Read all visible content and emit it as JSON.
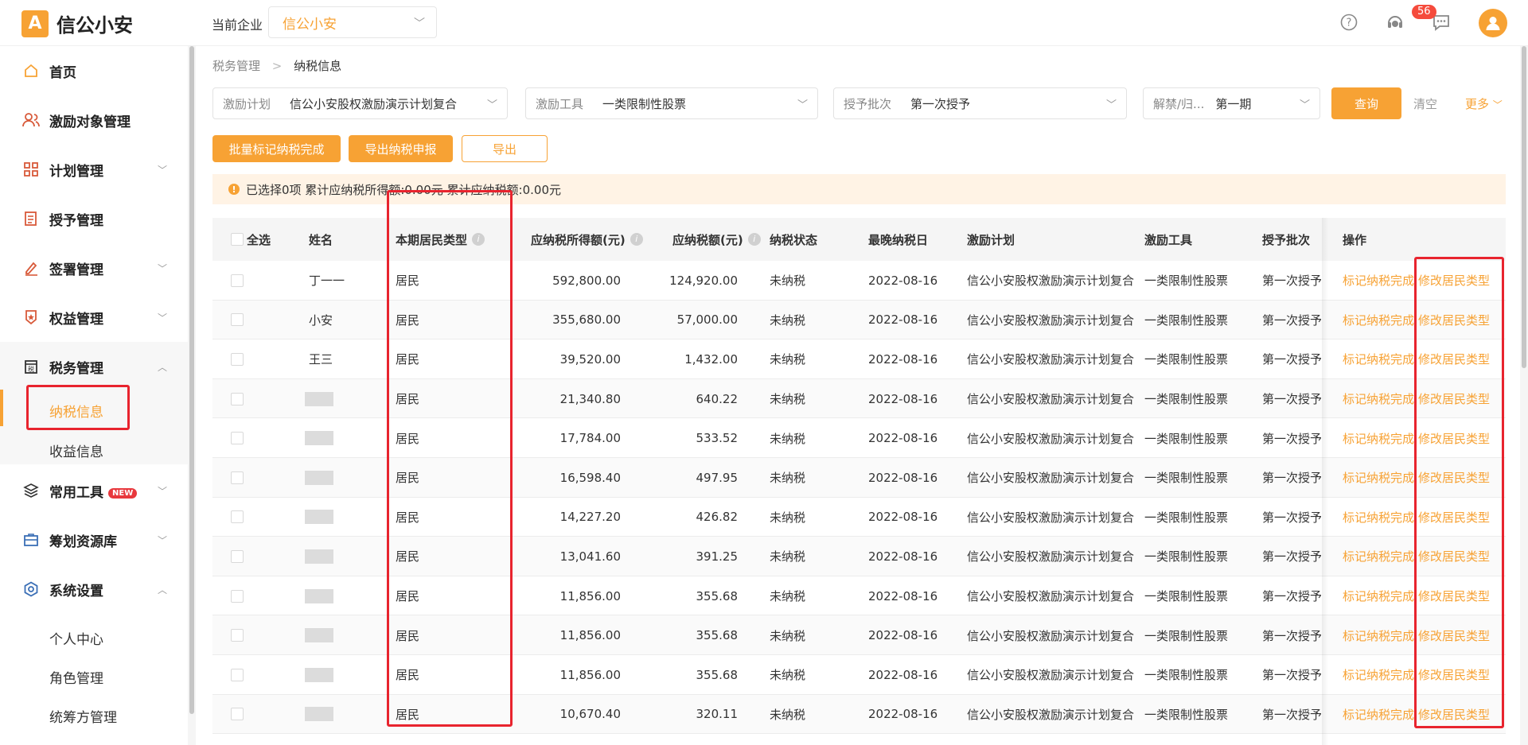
{
  "header": {
    "logo_mark": "A",
    "logo_text": "信公小安",
    "company_label": "当前企业",
    "company_value": "信公小安",
    "message_count": "56"
  },
  "sidebar": {
    "items": [
      {
        "label": "首页",
        "icon": "home-icon"
      },
      {
        "label": "激励对象管理",
        "icon": "users-icon"
      },
      {
        "label": "计划管理",
        "icon": "grid-icon"
      },
      {
        "label": "授予管理",
        "icon": "document-icon"
      },
      {
        "label": "签署管理",
        "icon": "pen-icon"
      },
      {
        "label": "权益管理",
        "icon": "star-icon"
      },
      {
        "label": "税务管理",
        "icon": "tax-icon"
      },
      {
        "label": "常用工具",
        "icon": "layers-icon"
      },
      {
        "label": "筹划资源库",
        "icon": "box-icon"
      },
      {
        "label": "系统设置",
        "icon": "settings-icon"
      }
    ],
    "tax_sub": [
      "纳税信息",
      "收益信息"
    ],
    "settings_sub": [
      "个人中心",
      "角色管理",
      "统筹方管理"
    ],
    "new_badge": "NEW"
  },
  "breadcrumb": {
    "parent": "税务管理",
    "separator": ">",
    "current": "纳税信息"
  },
  "filters": [
    {
      "label": "激励计划",
      "value": "信公小安股权激励演示计划复合"
    },
    {
      "label": "激励工具",
      "value": "一类限制性股票"
    },
    {
      "label": "授予批次",
      "value": "第一次授予"
    },
    {
      "label": "解禁/归...",
      "value": "第一期"
    }
  ],
  "actions": {
    "query": "查询",
    "clear": "清空",
    "more": "更多",
    "batch_mark": "批量标记纳税完成",
    "export_declare": "导出纳税申报",
    "export": "导出"
  },
  "alert": "已选择0项 累计应纳税所得额:0.00元 累计应纳税额:0.00元",
  "table": {
    "headers": {
      "select_all": "全选",
      "name": "姓名",
      "resident_type": "本期居民类型",
      "taxable_income": "应纳税所得额(元)",
      "tax_amount": "应纳税额(元)",
      "tax_status": "纳税状态",
      "deadline": "最晚纳税日",
      "plan": "激励计划",
      "tool": "激励工具",
      "batch": "授予批次",
      "ops": "操作"
    },
    "op_mark": "标记纳税完成",
    "op_modify": "修改居民类型",
    "rows": [
      {
        "name": "丁一一",
        "type": "居民",
        "income": "592,800.00",
        "tax": "124,920.00",
        "status": "未纳税",
        "date": "2022-08-16",
        "plan": "信公小安股权激励演示计划复合",
        "tool": "一类限制性股票",
        "batch": "第一次授予"
      },
      {
        "name": "小安",
        "type": "居民",
        "income": "355,680.00",
        "tax": "57,000.00",
        "status": "未纳税",
        "date": "2022-08-16",
        "plan": "信公小安股权激励演示计划复合",
        "tool": "一类限制性股票",
        "batch": "第一次授予"
      },
      {
        "name": "王三",
        "type": "居民",
        "income": "39,520.00",
        "tax": "1,432.00",
        "status": "未纳税",
        "date": "2022-08-16",
        "plan": "信公小安股权激励演示计划复合",
        "tool": "一类限制性股票",
        "batch": "第一次授予"
      },
      {
        "name": "",
        "type": "居民",
        "income": "21,340.80",
        "tax": "640.22",
        "status": "未纳税",
        "date": "2022-08-16",
        "plan": "信公小安股权激励演示计划复合",
        "tool": "一类限制性股票",
        "batch": "第一次授予"
      },
      {
        "name": "",
        "type": "居民",
        "income": "17,784.00",
        "tax": "533.52",
        "status": "未纳税",
        "date": "2022-08-16",
        "plan": "信公小安股权激励演示计划复合",
        "tool": "一类限制性股票",
        "batch": "第一次授予"
      },
      {
        "name": "",
        "type": "居民",
        "income": "16,598.40",
        "tax": "497.95",
        "status": "未纳税",
        "date": "2022-08-16",
        "plan": "信公小安股权激励演示计划复合",
        "tool": "一类限制性股票",
        "batch": "第一次授予"
      },
      {
        "name": "",
        "type": "居民",
        "income": "14,227.20",
        "tax": "426.82",
        "status": "未纳税",
        "date": "2022-08-16",
        "plan": "信公小安股权激励演示计划复合",
        "tool": "一类限制性股票",
        "batch": "第一次授予"
      },
      {
        "name": "",
        "type": "居民",
        "income": "13,041.60",
        "tax": "391.25",
        "status": "未纳税",
        "date": "2022-08-16",
        "plan": "信公小安股权激励演示计划复合",
        "tool": "一类限制性股票",
        "batch": "第一次授予"
      },
      {
        "name": "",
        "type": "居民",
        "income": "11,856.00",
        "tax": "355.68",
        "status": "未纳税",
        "date": "2022-08-16",
        "plan": "信公小安股权激励演示计划复合",
        "tool": "一类限制性股票",
        "batch": "第一次授予"
      },
      {
        "name": "",
        "type": "居民",
        "income": "11,856.00",
        "tax": "355.68",
        "status": "未纳税",
        "date": "2022-08-16",
        "plan": "信公小安股权激励演示计划复合",
        "tool": "一类限制性股票",
        "batch": "第一次授予"
      },
      {
        "name": "",
        "type": "居民",
        "income": "11,856.00",
        "tax": "355.68",
        "status": "未纳税",
        "date": "2022-08-16",
        "plan": "信公小安股权激励演示计划复合",
        "tool": "一类限制性股票",
        "batch": "第一次授予"
      },
      {
        "name": "",
        "type": "居民",
        "income": "10,670.40",
        "tax": "320.11",
        "status": "未纳税",
        "date": "2022-08-16",
        "plan": "信公小安股权激励演示计划复合",
        "tool": "一类限制性股票",
        "batch": "第一次授予"
      }
    ]
  },
  "colors": {
    "accent": "#f7a234",
    "highlight": "#e8242e",
    "alert_bg": "#fff3e5"
  }
}
